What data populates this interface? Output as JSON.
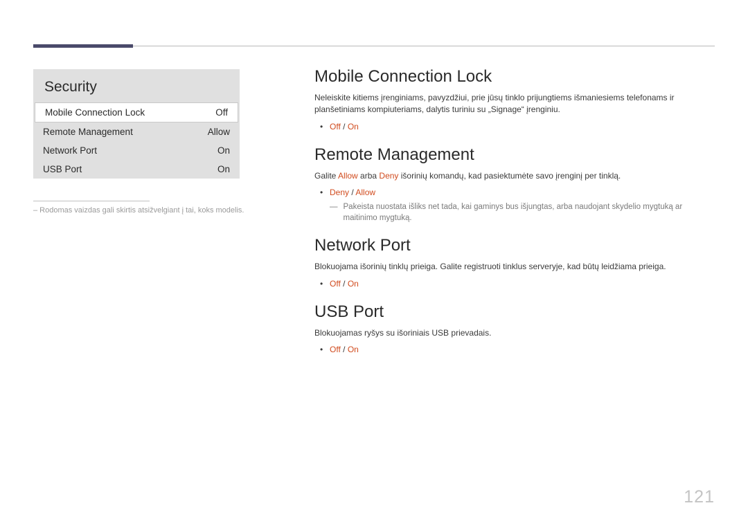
{
  "page_number": "121",
  "menu": {
    "title": "Security",
    "items": [
      {
        "label": "Mobile Connection Lock",
        "value": "Off"
      },
      {
        "label": "Remote Management",
        "value": "Allow"
      },
      {
        "label": "Network Port",
        "value": "On"
      },
      {
        "label": "USB Port",
        "value": "On"
      }
    ]
  },
  "footnote_text": "– Rodomas vaizdas gali skirtis atsižvelgiant į tai, koks modelis.",
  "sections": {
    "mcl": {
      "heading": "Mobile Connection Lock",
      "desc": "Neleiskite kitiems įrenginiams, pavyzdžiui, prie jūsų tinklo prijungtiems išmaniesiems telefonams ir planšetiniams kompiuteriams, dalytis turiniu su „Signage“ įrenginiu.",
      "opt1": "Off",
      "sep": " / ",
      "opt2": "On"
    },
    "rm": {
      "heading": "Remote Management",
      "desc_pre": "Galite ",
      "allow": "Allow",
      "desc_mid": " arba ",
      "deny": "Deny",
      "desc_post": " išorinių komandų, kad pasiektumėte savo įrenginį per tinklą.",
      "opt1": "Deny",
      "sep": " / ",
      "opt2": "Allow",
      "note": "Pakeista nuostata išliks net tada, kai gaminys bus išjungtas, arba naudojant skydelio mygtuką ar maitinimo mygtuką."
    },
    "np": {
      "heading": "Network Port",
      "desc": "Blokuojama išorinių tinklų prieiga. Galite registruoti tinklus serveryje, kad būtų leidžiama prieiga.",
      "opt1": "Off",
      "sep": " / ",
      "opt2": "On"
    },
    "usb": {
      "heading": "USB Port",
      "desc": "Blokuojamas ryšys su išoriniais USB prievadais.",
      "opt1": "Off",
      "sep": " / ",
      "opt2": "On"
    }
  }
}
